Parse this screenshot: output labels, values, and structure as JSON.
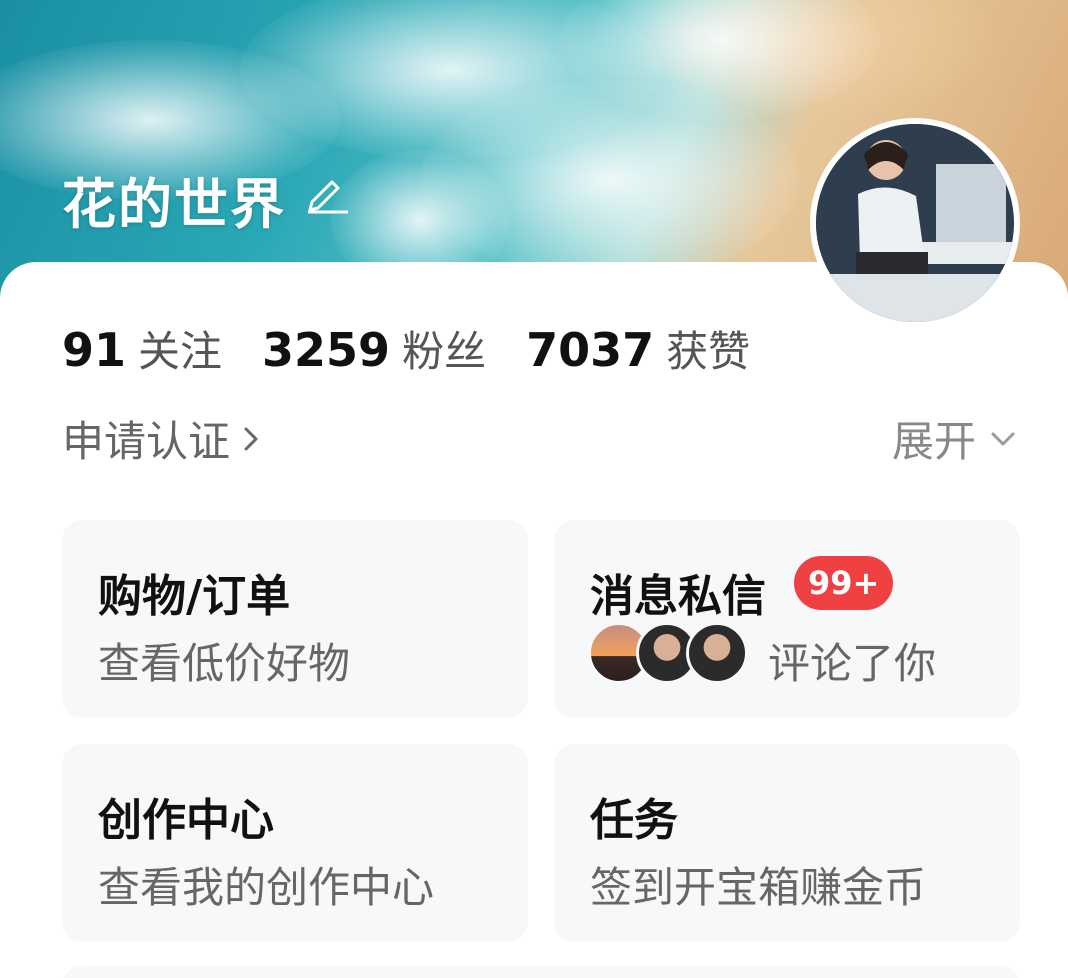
{
  "profile": {
    "username": "花的世界",
    "stats": [
      {
        "value": "91",
        "label": "关注"
      },
      {
        "value": "3259",
        "label": "粉丝"
      },
      {
        "value": "7037",
        "label": "获赞"
      }
    ],
    "verify_label": "申请认证",
    "expand_label": "展开"
  },
  "tiles": {
    "shopping": {
      "title": "购物/订单",
      "subtitle": "查看低价好物"
    },
    "messages": {
      "title": "消息私信",
      "badge": "99+",
      "subtitle": "评论了你"
    },
    "creator": {
      "title": "创作中心",
      "subtitle": "查看我的创作中心"
    },
    "tasks": {
      "title": "任务",
      "subtitle": "签到开宝箱赚金币"
    }
  },
  "colors": {
    "badge": "#f04142",
    "tile_bg": "#f7f8f9",
    "ocean": "#2aa7b5",
    "sand": "#d9a877"
  },
  "icons": {
    "edit": "edit-icon",
    "chevron_right": "chevron-right-icon",
    "chevron_down": "chevron-down-icon"
  }
}
